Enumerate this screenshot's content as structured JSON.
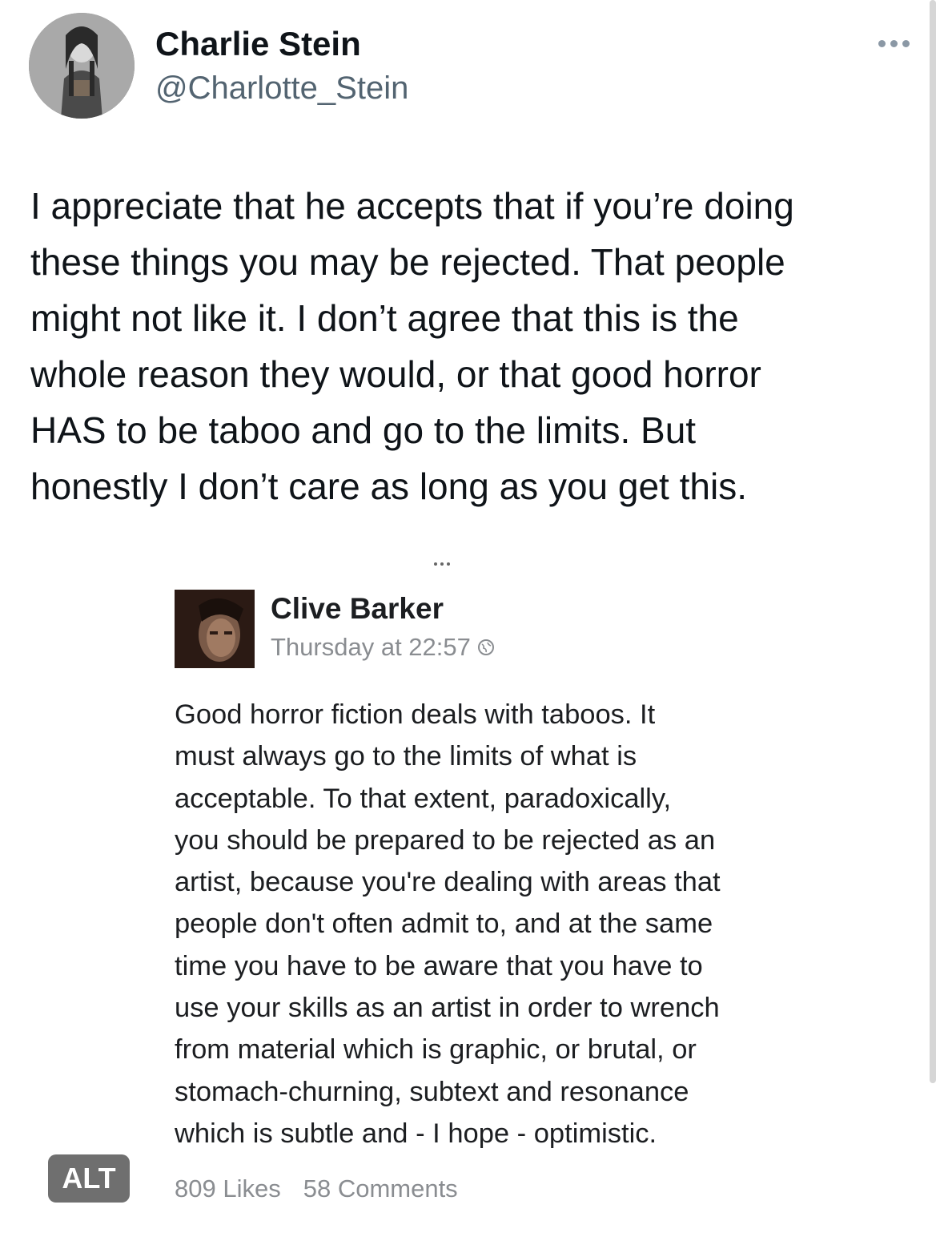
{
  "tweet": {
    "author": {
      "display_name": "Charlie Stein",
      "handle": "@Charlotte_Stein"
    },
    "more_icon": "ellipsis-horizontal-icon",
    "text_lines": [
      "I appreciate that he accepts that if you’re doing",
      "these things you may be rejected. That people",
      "might not like it. I don’t agree that this is the",
      "whole reason they would, or that good horror",
      "HAS to be taboo and go to the limits. But",
      "honestly I don’t care as long as you get this."
    ],
    "alt_badge": "ALT"
  },
  "embedded_post": {
    "author": "Clive Barker",
    "timestamp": "Thursday at 22:57",
    "audience_icon": "globe-icon",
    "body_lines": [
      "Good horror fiction deals with taboos. It",
      "must always go to the limits of what is",
      "acceptable. To that extent, paradoxically,",
      "you should be prepared to be rejected as an",
      "artist, because you're dealing with areas that",
      "people don't often admit to, and at the same",
      "time you have to be aware that you have to",
      "use your skills as an artist in order to wrench",
      "from material which is graphic, or brutal, or",
      "stomach-churning, subtext and resonance",
      "which is subtle and - I hope - optimistic."
    ],
    "likes": "809 Likes",
    "comments": "58 Comments"
  },
  "colors": {
    "text_primary": "#0f1419",
    "text_secondary": "#536471",
    "fb_text": "#1c1e21",
    "fb_meta": "#8a8d91",
    "alt_badge_bg": "#6f6f6f"
  }
}
